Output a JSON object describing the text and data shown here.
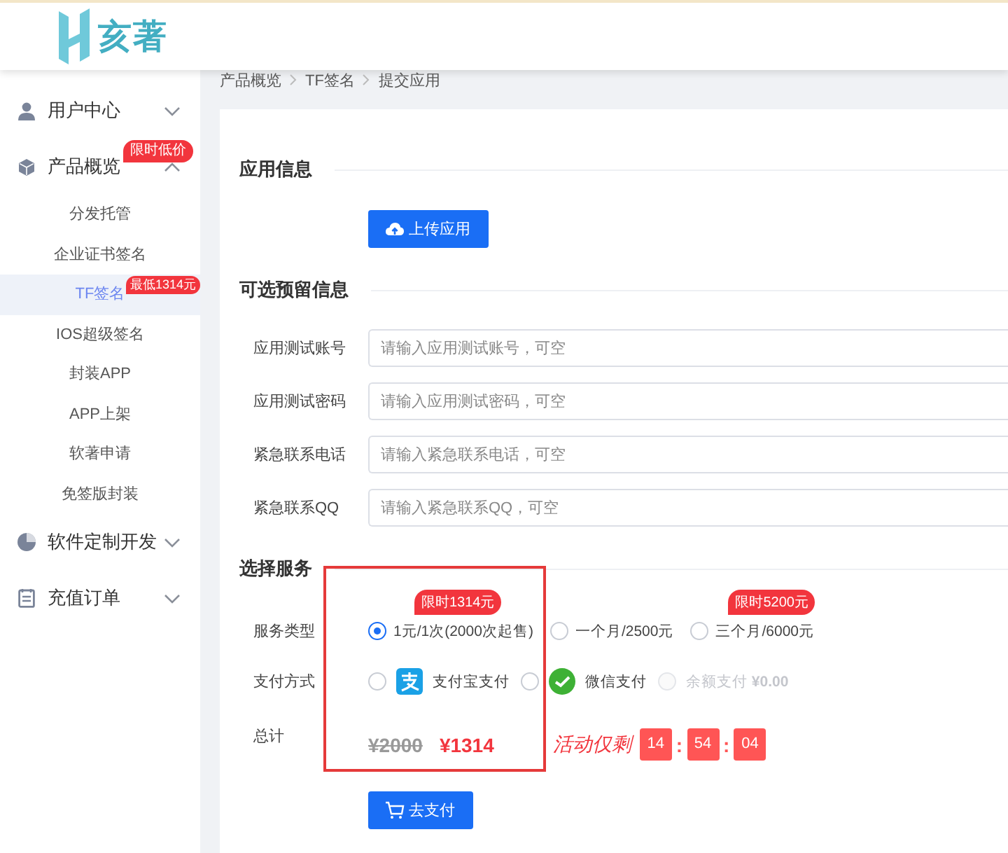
{
  "logo": {
    "text": "亥著"
  },
  "sidebar": {
    "items": [
      {
        "label": "用户中心",
        "expanded": false
      },
      {
        "label": "产品概览",
        "expanded": true,
        "badge": "限时低价",
        "children": [
          {
            "label": "分发托管",
            "selected": false
          },
          {
            "label": "企业证书签名",
            "selected": false
          },
          {
            "label": "TF签名",
            "selected": true,
            "badge": "最低1314元"
          },
          {
            "label": "IOS超级签名",
            "selected": false
          },
          {
            "label": "封装APP",
            "selected": false
          },
          {
            "label": "APP上架",
            "selected": false
          },
          {
            "label": "软著申请",
            "selected": false
          },
          {
            "label": "免签版封装",
            "selected": false
          }
        ]
      },
      {
        "label": "软件定制开发",
        "expanded": false
      },
      {
        "label": "充值订单",
        "expanded": false
      }
    ]
  },
  "breadcrumb": [
    "产品概览",
    "TF签名",
    "提交应用"
  ],
  "app_info": {
    "title": "应用信息",
    "upload_button": "上传应用"
  },
  "optional_info": {
    "title": "可选预留信息",
    "fields": [
      {
        "label": "应用测试账号",
        "placeholder": "请输入应用测试账号，可空"
      },
      {
        "label": "应用测试密码",
        "placeholder": "请输入应用测试密码，可空"
      },
      {
        "label": "紧急联系电话",
        "placeholder": "请输入紧急联系电话，可空"
      },
      {
        "label": "紧急联系QQ",
        "placeholder": "请输入紧急联系QQ，可空"
      }
    ]
  },
  "service": {
    "title": "选择服务",
    "highlighted": true,
    "service_type": {
      "label": "服务类型",
      "options": [
        {
          "label": "1元/1次(2000次起售)",
          "selected": true,
          "badge": "限时1314元"
        },
        {
          "label": "一个月/2500元",
          "selected": false
        },
        {
          "label": "三个月/6000元",
          "selected": false,
          "badge": "限时5200元"
        }
      ]
    },
    "payment": {
      "label": "支付方式",
      "options": [
        {
          "label": "支付宝支付",
          "selected": false,
          "disabled": false
        },
        {
          "label": "微信支付",
          "selected": false,
          "disabled": false
        },
        {
          "label": "余额支付 **¥0.00**",
          "selected": false,
          "disabled": true
        }
      ]
    },
    "total": {
      "label": "总计",
      "original_price": "¥2000",
      "price": "¥1314",
      "countdown_label": "活动仅剩",
      "countdown": [
        "14",
        "54",
        "04"
      ],
      "separator": ":"
    },
    "pay_button": "去支付"
  }
}
